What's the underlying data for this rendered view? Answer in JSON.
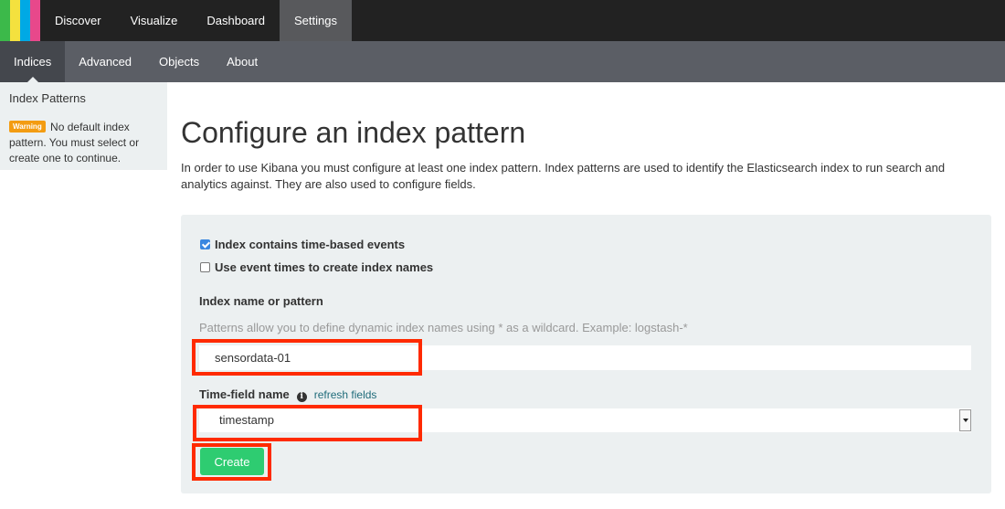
{
  "colors": {
    "logo_stripes": [
      "#e8488b",
      "#f4e13e",
      "#3cb94a",
      "#00a9e5"
    ],
    "accent_create": "#2ecc71",
    "highlight": "#ff2a00",
    "warning": "#f39c12"
  },
  "topnav": {
    "tabs": [
      {
        "label": "Discover",
        "active": false
      },
      {
        "label": "Visualize",
        "active": false
      },
      {
        "label": "Dashboard",
        "active": false
      },
      {
        "label": "Settings",
        "active": true
      }
    ]
  },
  "subnav": {
    "tabs": [
      {
        "label": "Indices",
        "active": true
      },
      {
        "label": "Advanced",
        "active": false
      },
      {
        "label": "Objects",
        "active": false
      },
      {
        "label": "About",
        "active": false
      }
    ]
  },
  "sidebar": {
    "title": "Index Patterns",
    "warning_badge": "Warning",
    "warning_text": "No default index pattern. You must select or create one to continue."
  },
  "main": {
    "title": "Configure an index pattern",
    "intro": "In order to use Kibana you must configure at least one index pattern. Index patterns are used to identify the Elasticsearch index to run search and analytics against. They are also used to configure fields."
  },
  "form": {
    "time_based": {
      "label": "Index contains time-based events",
      "checked": true
    },
    "event_times": {
      "label": "Use event times to create index names",
      "checked": false
    },
    "index_label": "Index name or pattern",
    "index_help": "Patterns allow you to define dynamic index names using * as a wildcard. Example: logstash-*",
    "index_value": "sensordata-01",
    "time_field_label": "Time-field name",
    "info_icon_glyph": "i",
    "refresh_link": "refresh fields",
    "time_field_value": "timestamp",
    "create_label": "Create"
  }
}
